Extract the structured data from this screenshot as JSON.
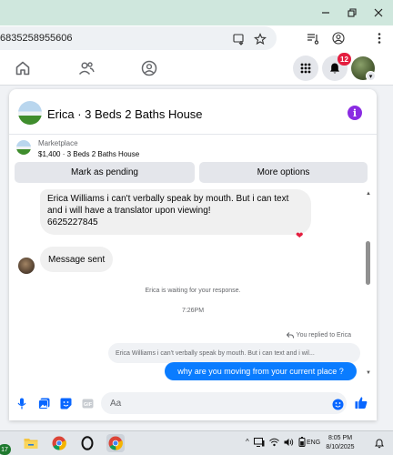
{
  "browser": {
    "url_partial": "6835258955606",
    "window_controls": [
      "minimize",
      "restore",
      "close"
    ],
    "icons": [
      "install-app-icon",
      "bookmark-star-icon",
      "media-queue-icon",
      "account-icon",
      "browser-menu-icon"
    ]
  },
  "topbar": {
    "nav_icons": [
      "home-icon",
      "friends-icon",
      "groups-icon"
    ],
    "notification_count": "12",
    "colors": {
      "badge": "#e41e3f",
      "inactive_icon": "#65676b"
    }
  },
  "chat": {
    "title": "Erica · 3 Beds 2 Baths House",
    "listing": {
      "source": "Marketplace",
      "description": "$1,400 · 3 Beds 2 Baths House"
    },
    "actions": {
      "mark_pending": "Mark as pending",
      "more_options": "More options"
    },
    "messages": [
      {
        "direction": "incoming",
        "text": "Erica Williams i can't verbally speak by mouth. But i can text and i will have a translator upon viewing!\n6625227845",
        "reaction": "❤"
      },
      {
        "direction": "incoming",
        "text": "Message sent"
      }
    ],
    "waiting_status": "Erica is waiting for your response.",
    "time_divider": "7:26PM",
    "reply_note": "You replied to Erica",
    "quoted_preview": "Erica Williams i can't verbally speak by mouth. But i can text and i wil...",
    "outgoing_message": "why are you moving from your current place ?",
    "composer": {
      "placeholder": "Aa"
    },
    "colors": {
      "outgoing_bubble": "#0a7cff",
      "accent": "#0866ff",
      "info": "#8a2be2"
    }
  },
  "taskbar": {
    "app_badge": "17",
    "apps": [
      "file-explorer",
      "chrome",
      "opera-gx",
      "chrome-active"
    ],
    "language": "ENG",
    "time": "8:05 PM",
    "date": "8/10/2025"
  }
}
